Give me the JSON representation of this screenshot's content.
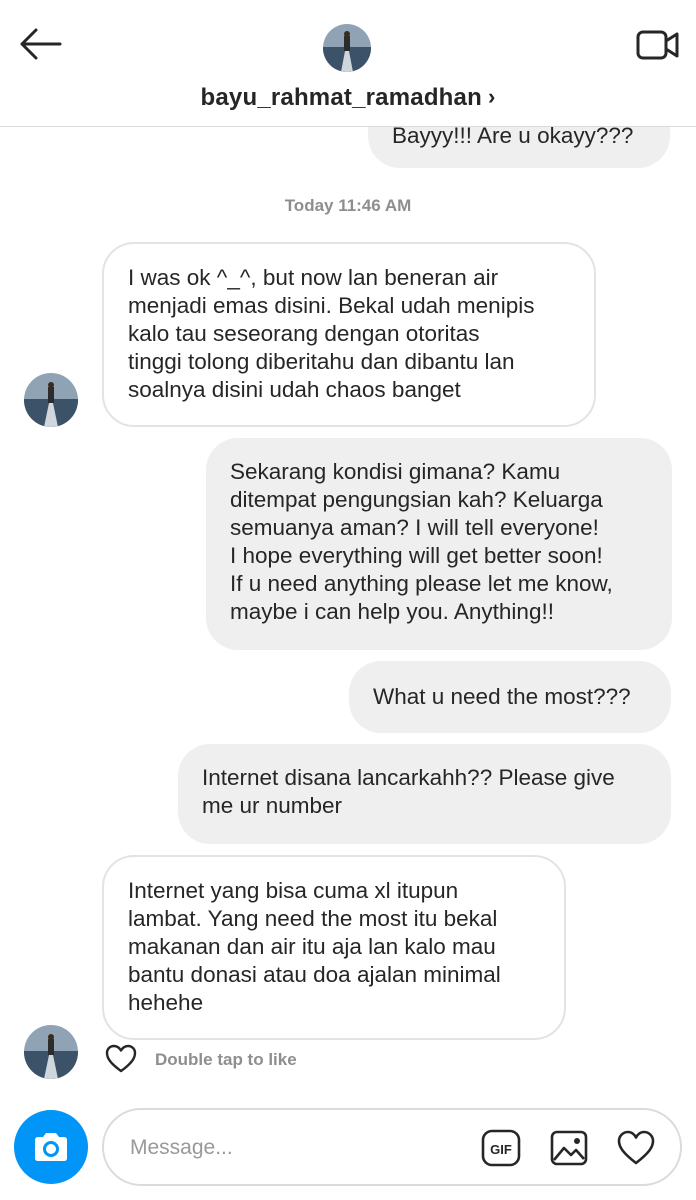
{
  "header": {
    "username": "bayu_rahmat_ramadhan",
    "chevron": "›",
    "icons": {
      "back": "back-arrow-icon",
      "video": "video-call-icon"
    }
  },
  "messages": [
    {
      "side": "out",
      "text": "Bayyy!!! Are u okayy???"
    },
    {
      "side": "divider",
      "text": "Today 11:46 AM"
    },
    {
      "side": "in",
      "text": "I was ok ^_^, but now lan beneran air\nmenjadi emas disini. Bekal udah menipis\nkalo tau seseorang dengan otoritas\ntinggi tolong diberitahu dan dibantu lan\nsoalnya disini udah chaos banget"
    },
    {
      "side": "out",
      "text": "Sekarang kondisi gimana? Kamu\nditempat pengungsian kah? Keluarga\nsemuanya aman? I will tell everyone!\nI hope everything will get better soon!\nIf u need anything please let me know,\nmaybe i can help you. Anything!!"
    },
    {
      "side": "out",
      "text": "What u need the most???"
    },
    {
      "side": "out",
      "text": "Internet disana lancarkahh?? Please give\nme ur number"
    },
    {
      "side": "in",
      "text": "Internet yang bisa cuma xl itupun\nlambat. Yang need the most itu bekal\nmakanan dan air itu aja lan kalo mau\nbantu donasi atau doa ajalan minimal\nhehehe"
    }
  ],
  "like_hint": "Double tap to like",
  "composer": {
    "placeholder": "Message...",
    "gif_label": "GIF",
    "icons": {
      "camera": "camera-icon",
      "image": "image-icon",
      "heart": "heart-icon"
    }
  },
  "colors": {
    "accent": "#0095f6",
    "outgoing_bubble": "#efefef",
    "incoming_border": "#e3e3e3",
    "muted_text": "#8e8e8e"
  }
}
